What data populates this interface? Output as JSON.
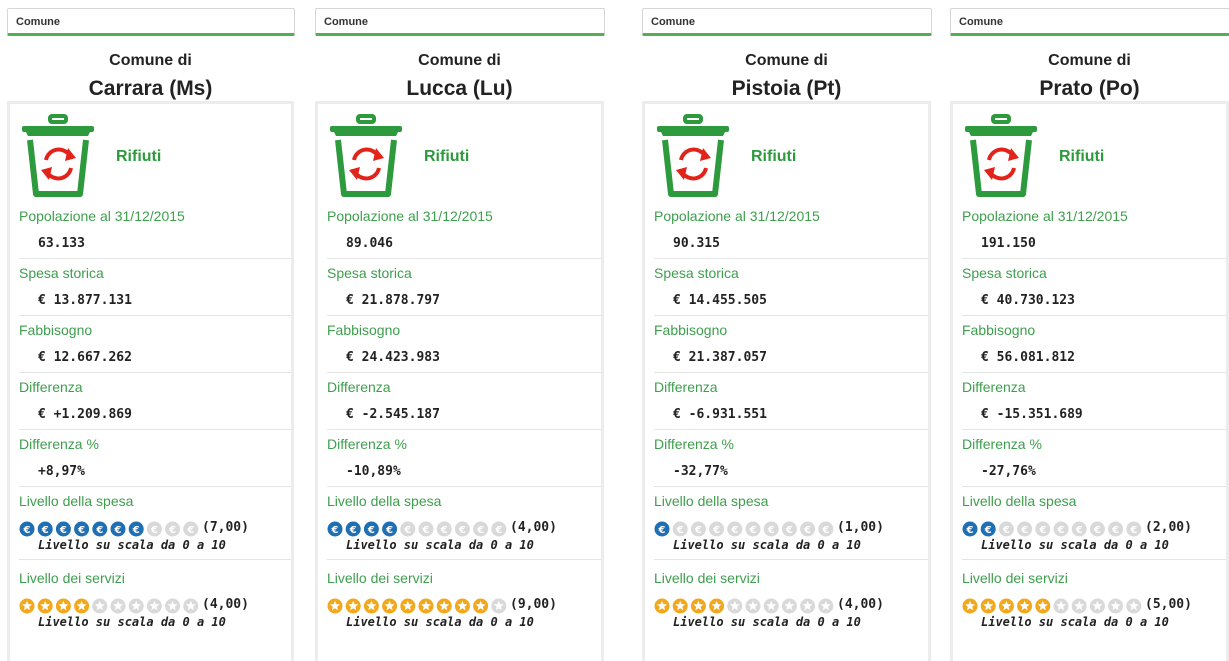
{
  "colors": {
    "green_label": "#3d9f4d",
    "bin_green": "#2e9a3e",
    "recycle_red": "#e2231a",
    "euro_filled": "#1f6fb2",
    "euro_empty": "#d9d9d9",
    "star_filled": "#f2a81d",
    "star_empty": "#d9d9d9",
    "selector_underline": "#52b052"
  },
  "icons": {
    "category": "trash-bin-recycle-icon",
    "spesa": "euro-coin-icon",
    "servizi": "star-icon"
  },
  "columns": [
    {
      "selector_label": "Comune",
      "title_line1": "Comune di",
      "title_line2": "Carrara (Ms)",
      "category": "Rifiuti",
      "popolazione_label": "Popolazione al 31/12/2015",
      "popolazione": "63.133",
      "spesa_storica_label": "Spesa storica",
      "spesa_storica": "€ 13.877.131",
      "fabbisogno_label": "Fabbisogno",
      "fabbisogno": "€ 12.667.262",
      "differenza_label": "Differenza",
      "differenza": "€ +1.209.869",
      "differenza_pct_label": "Differenza %",
      "differenza_pct": "+8,97%",
      "livello_spesa_label": "Livello della spesa",
      "livello_spesa": 7,
      "livello_spesa_text": "(7,00)",
      "livello_spesa_scale": "Livello su scala da 0 a 10",
      "livello_servizi_label": "Livello dei servizi",
      "livello_servizi": 4,
      "livello_servizi_text": "(4,00)",
      "livello_servizi_scale": "Livello su scala da 0 a 10"
    },
    {
      "selector_label": "Comune",
      "title_line1": "Comune di",
      "title_line2": "Lucca (Lu)",
      "category": "Rifiuti",
      "popolazione_label": "Popolazione al 31/12/2015",
      "popolazione": "89.046",
      "spesa_storica_label": "Spesa storica",
      "spesa_storica": "€ 21.878.797",
      "fabbisogno_label": "Fabbisogno",
      "fabbisogno": "€ 24.423.983",
      "differenza_label": "Differenza",
      "differenza": "€ -2.545.187",
      "differenza_pct_label": "Differenza %",
      "differenza_pct": "-10,89%",
      "livello_spesa_label": "Livello della spesa",
      "livello_spesa": 4,
      "livello_spesa_text": "(4,00)",
      "livello_spesa_scale": "Livello su scala da 0 a 10",
      "livello_servizi_label": "Livello dei servizi",
      "livello_servizi": 9,
      "livello_servizi_text": "(9,00)",
      "livello_servizi_scale": "Livello su scala da 0 a 10"
    },
    {
      "selector_label": "Comune",
      "title_line1": "Comune di",
      "title_line2": "Pistoia (Pt)",
      "category": "Rifiuti",
      "popolazione_label": "Popolazione al 31/12/2015",
      "popolazione": "90.315",
      "spesa_storica_label": "Spesa storica",
      "spesa_storica": "€ 14.455.505",
      "fabbisogno_label": "Fabbisogno",
      "fabbisogno": "€ 21.387.057",
      "differenza_label": "Differenza",
      "differenza": "€ -6.931.551",
      "differenza_pct_label": "Differenza %",
      "differenza_pct": "-32,77%",
      "livello_spesa_label": "Livello della spesa",
      "livello_spesa": 1,
      "livello_spesa_text": "(1,00)",
      "livello_spesa_scale": "Livello su scala da 0 a 10",
      "livello_servizi_label": "Livello dei servizi",
      "livello_servizi": 4,
      "livello_servizi_text": "(4,00)",
      "livello_servizi_scale": "Livello su scala da 0 a 10"
    },
    {
      "selector_label": "Comune",
      "title_line1": "Comune di",
      "title_line2": "Prato (Po)",
      "category": "Rifiuti",
      "popolazione_label": "Popolazione al 31/12/2015",
      "popolazione": "191.150",
      "spesa_storica_label": "Spesa storica",
      "spesa_storica": "€ 40.730.123",
      "fabbisogno_label": "Fabbisogno",
      "fabbisogno": "€ 56.081.812",
      "differenza_label": "Differenza",
      "differenza": "€ -15.351.689",
      "differenza_pct_label": "Differenza %",
      "differenza_pct": "-27,76%",
      "livello_spesa_label": "Livello della spesa",
      "livello_spesa": 2,
      "livello_spesa_text": "(2,00)",
      "livello_spesa_scale": "Livello su scala da 0 a 10",
      "livello_servizi_label": "Livello dei servizi",
      "livello_servizi": 5,
      "livello_servizi_text": "(5,00)",
      "livello_servizi_scale": "Livello su scala da 0 a 10"
    }
  ]
}
